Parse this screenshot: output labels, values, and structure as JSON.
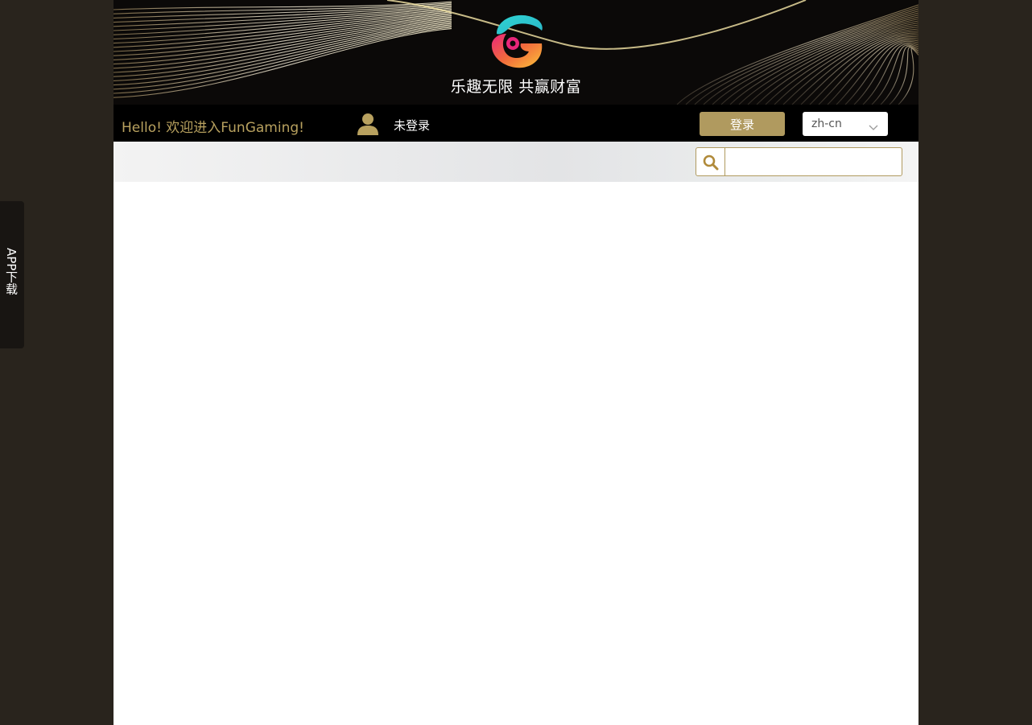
{
  "banner": {
    "slogan": "乐趣无限 共赢财富",
    "logo_icon": "swirl-g-logo-icon"
  },
  "topbar": {
    "greeting": "Hello! 欢迎进入FunGaming!",
    "user_icon": "user-icon",
    "login_status": "未登录",
    "login_button_label": "登录",
    "language": {
      "selected": "zh-cn",
      "chevron_icon": "chevron-down-icon"
    }
  },
  "search": {
    "icon": "search-icon",
    "value": "",
    "placeholder": ""
  },
  "side_tab": {
    "label": "APP下载"
  },
  "colors": {
    "background": "#29241d",
    "accent_gold": "#b09a5f",
    "greeting_gold": "#b8a15f",
    "topbar_black": "#000000",
    "banner_black": "#0b0908"
  }
}
